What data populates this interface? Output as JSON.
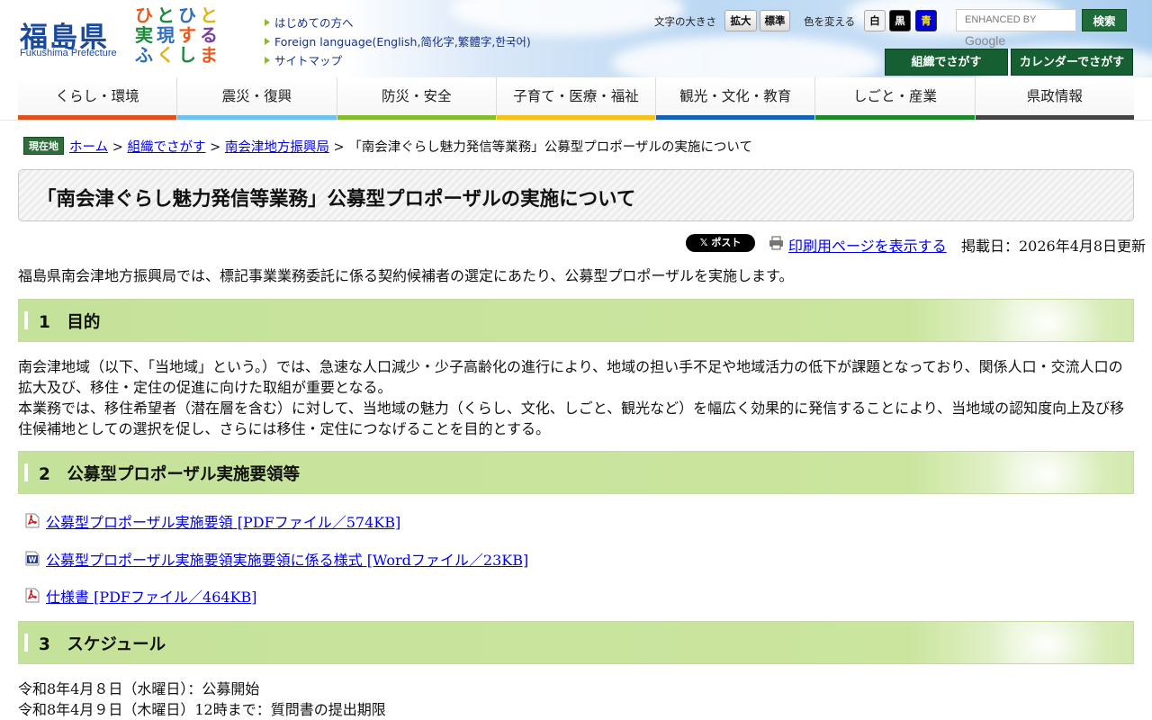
{
  "header": {
    "logo_text": "福島県",
    "logo_sub": "Fukushima Prefecture",
    "emblem_chars": [
      "ひ",
      "と",
      "ひ",
      "と",
      "実",
      "現",
      "す",
      "る",
      "ふ",
      "く",
      "し",
      "ま"
    ],
    "quicklinks": [
      "はじめての方へ",
      "Foreign language(English,简化字,繁體字,한국어)",
      "サイトマップ"
    ],
    "font_size_label": "文字の大きさ",
    "font_enlarge": "拡大",
    "font_standard": "標準",
    "color_label": "色を変える",
    "color_white": "白",
    "color_black": "黒",
    "color_blue": "青",
    "search_placeholder_prefix": "ENHANCED BY",
    "search_placeholder_brand": "Google",
    "search_button": "検索",
    "org_button": "組織でさがす",
    "calendar_button": "カレンダーでさがす"
  },
  "nav": [
    {
      "label": "くらし・環境",
      "color": "#e0501c"
    },
    {
      "label": "震災・復興",
      "color": "#6fc2ea"
    },
    {
      "label": "防災・安全",
      "color": "#86bb2b"
    },
    {
      "label": "子育て・医療・福祉",
      "color": "#f2c21a"
    },
    {
      "label": "観光・文化・教育",
      "color": "#1561b5"
    },
    {
      "label": "しごと・産業",
      "color": "#1d8a2a"
    },
    {
      "label": "県政情報",
      "color": "#444444"
    }
  ],
  "breadcrumb": {
    "here": "現在地",
    "home": "ホーム",
    "sep": ">",
    "org": "組織でさがす",
    "office": "南会津地方振興局",
    "current": "「南会津ぐらし魅力発信等業務」公募型プロポーザルの実施について"
  },
  "page_title": "「南会津ぐらし魅力発信等業務」公募型プロポーザルの実施について",
  "tools": {
    "x_post": "𝕏 ポスト",
    "print": "印刷用ページを表示する",
    "post_date": "掲載日：2026年4月8日更新"
  },
  "intro": "福島県南会津地方振興局では、標記事業業務委託に係る契約候補者の選定にあたり、公募型プロポーザルを実施します。",
  "sections": [
    {
      "heading": "1　目的"
    },
    {
      "heading": "2　公募型プロポーザル実施要領等"
    },
    {
      "heading": "3　スケジュール"
    }
  ],
  "purpose_lines": [
    "南会津地域（以下、「当地域」という。）では、急速な人口減少・少子高齢化の進行により、地域の担い手不足や地域活力の低下が課題となっており、関係人口・交流人口の拡大及び、移住・定住の促進に向けた取組が重要となる。",
    "本業務では、移住希望者（潜在層を含む）に対して、当地域の魅力（くらし、文化、しごと、観光など）を幅広く効果的に発信することにより、当地域の認知度向上及び移住候補地としての選択を促し、さらには移住・定住につなげることを目的とする。"
  ],
  "files": [
    {
      "label": "公募型プロポーザル実施要領 [PDFファイル／574KB]",
      "type": "pdf"
    },
    {
      "label": "公募型プロポーザル実施要領実施要領に係る様式 [Wordファイル／23KB]",
      "type": "word"
    },
    {
      "label": "仕様書 [PDFファイル／464KB]",
      "type": "pdf"
    }
  ],
  "schedule": [
    "令和8年4月８日（水曜日）：公募開始",
    "令和8年4月９日（木曜日）12時まで：質問書の提出期限"
  ]
}
